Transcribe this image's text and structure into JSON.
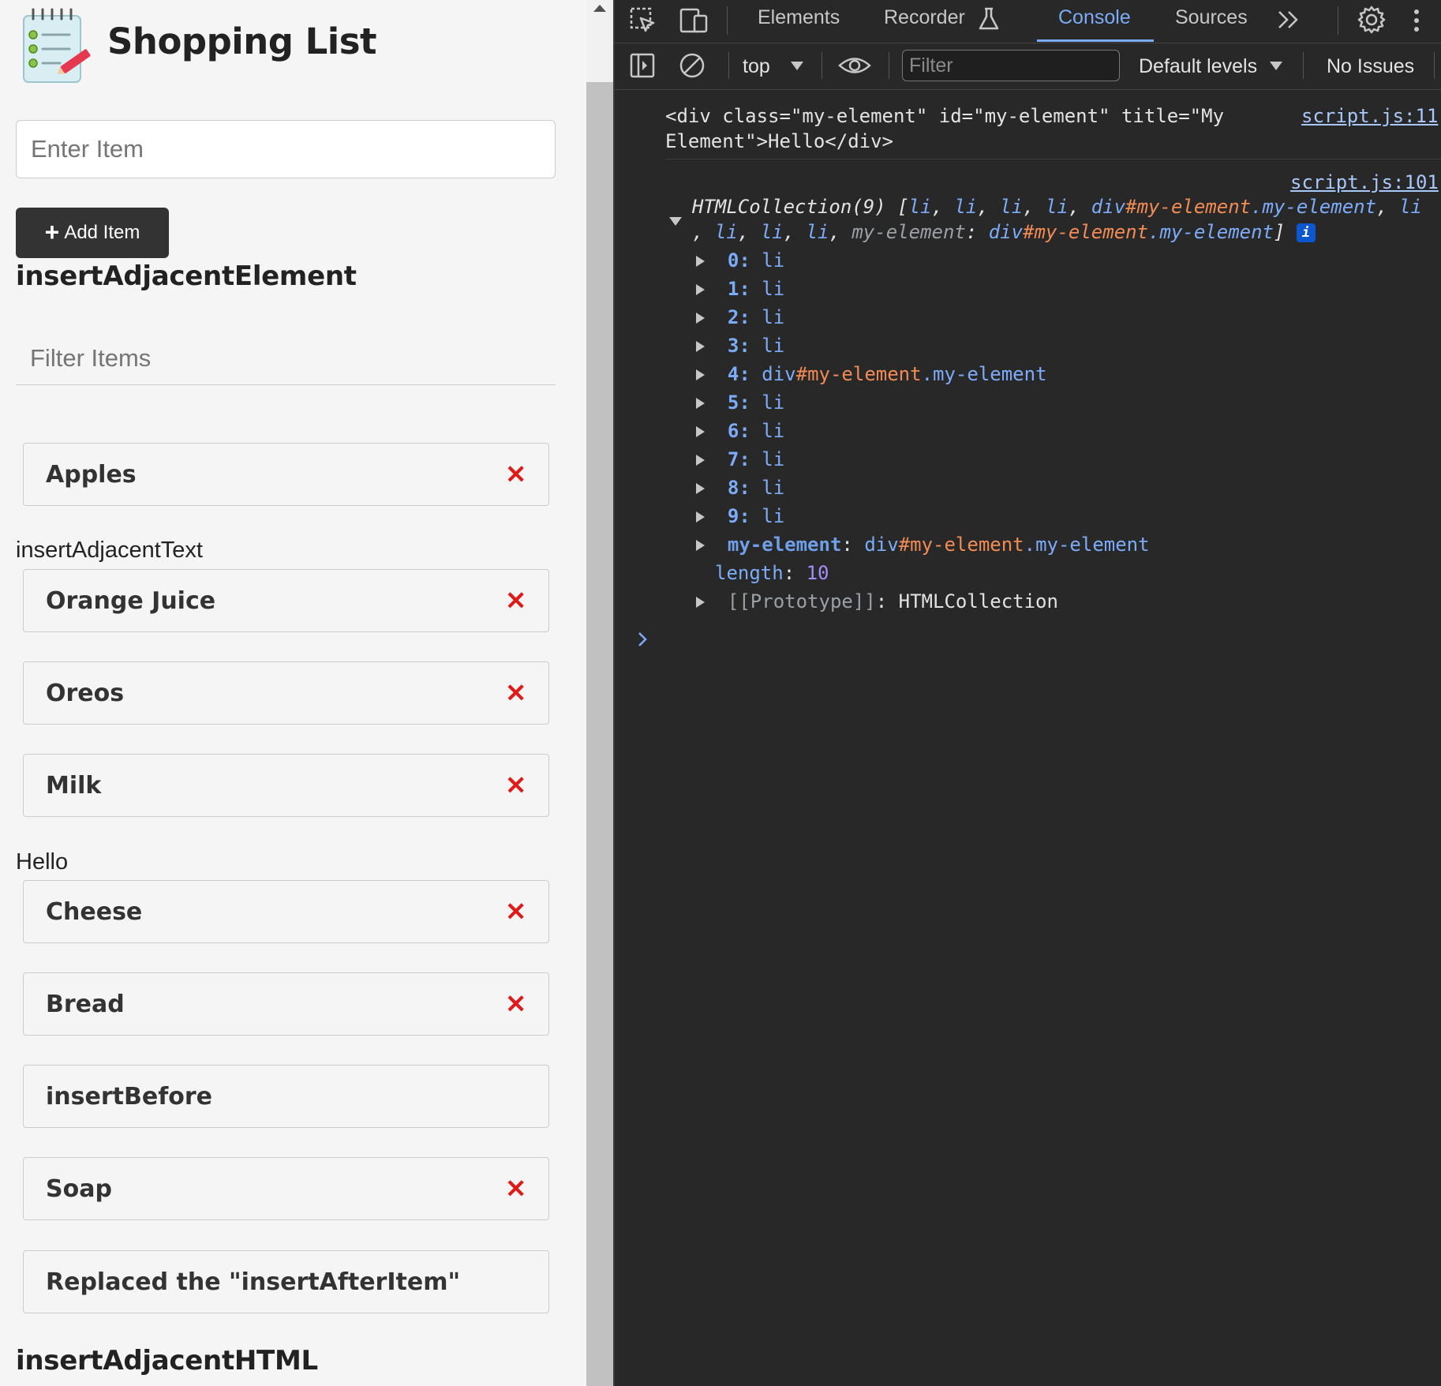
{
  "page": {
    "title": "Shopping List",
    "item_input_placeholder": "Enter Item",
    "add_button_label": "Add Item",
    "heading_1": "insertAdjacentElement",
    "filter_placeholder": "Filter Items",
    "text_1": "insertAdjacentText",
    "text_2": "Hello",
    "heading_2": "insertAdjacentHTML",
    "items": [
      {
        "label": "Apples",
        "removable": true
      },
      {
        "label": "Orange Juice",
        "removable": true
      },
      {
        "label": "Oreos",
        "removable": true
      },
      {
        "label": "Milk",
        "removable": true
      },
      {
        "label": "Cheese",
        "removable": true
      },
      {
        "label": "Bread",
        "removable": true
      },
      {
        "label": "insertBefore",
        "removable": false
      },
      {
        "label": "Soap",
        "removable": true
      },
      {
        "label": "Replaced the \"insertAfterItem\"",
        "removable": false
      }
    ],
    "remove_glyph": "✕",
    "colors": {
      "remove": "#e01919",
      "button_bg": "#333333",
      "page_bg": "#f5f5f5"
    }
  },
  "devtools": {
    "tabs": [
      "Elements",
      "Recorder",
      "Console",
      "Sources"
    ],
    "active_tab": "Console",
    "context": "top",
    "filter_placeholder": "Filter",
    "levels": "Default levels",
    "issues": "No Issues",
    "log1": {
      "line1": "<div class=\"my-element\" id=\"my-element\" title=\"My",
      "line2": "Element\">Hello</div>",
      "source": "script.js:11"
    },
    "log2": {
      "source": "script.js:101",
      "summary_prefix": "HTMLCollection(9) [",
      "entries": [
        {
          "key": "0",
          "value": "li"
        },
        {
          "key": "1",
          "value": "li"
        },
        {
          "key": "2",
          "value": "li"
        },
        {
          "key": "3",
          "value": "li"
        },
        {
          "key": "4",
          "value": "div#my-element.my-element"
        },
        {
          "key": "5",
          "value": "li"
        },
        {
          "key": "6",
          "value": "li"
        },
        {
          "key": "7",
          "value": "li"
        },
        {
          "key": "8",
          "value": "li"
        },
        {
          "key": "9",
          "value": "li"
        }
      ],
      "named_key": "my-element",
      "named_value": "div#my-element.my-element",
      "length_key": "length",
      "length_value": "10",
      "proto_key": "[[Prototype]]",
      "proto_value": "HTMLCollection"
    },
    "colors": {
      "accent": "#7cacf8",
      "id": "#f28b54",
      "number": "#a78bfa",
      "bg": "#282828"
    }
  }
}
